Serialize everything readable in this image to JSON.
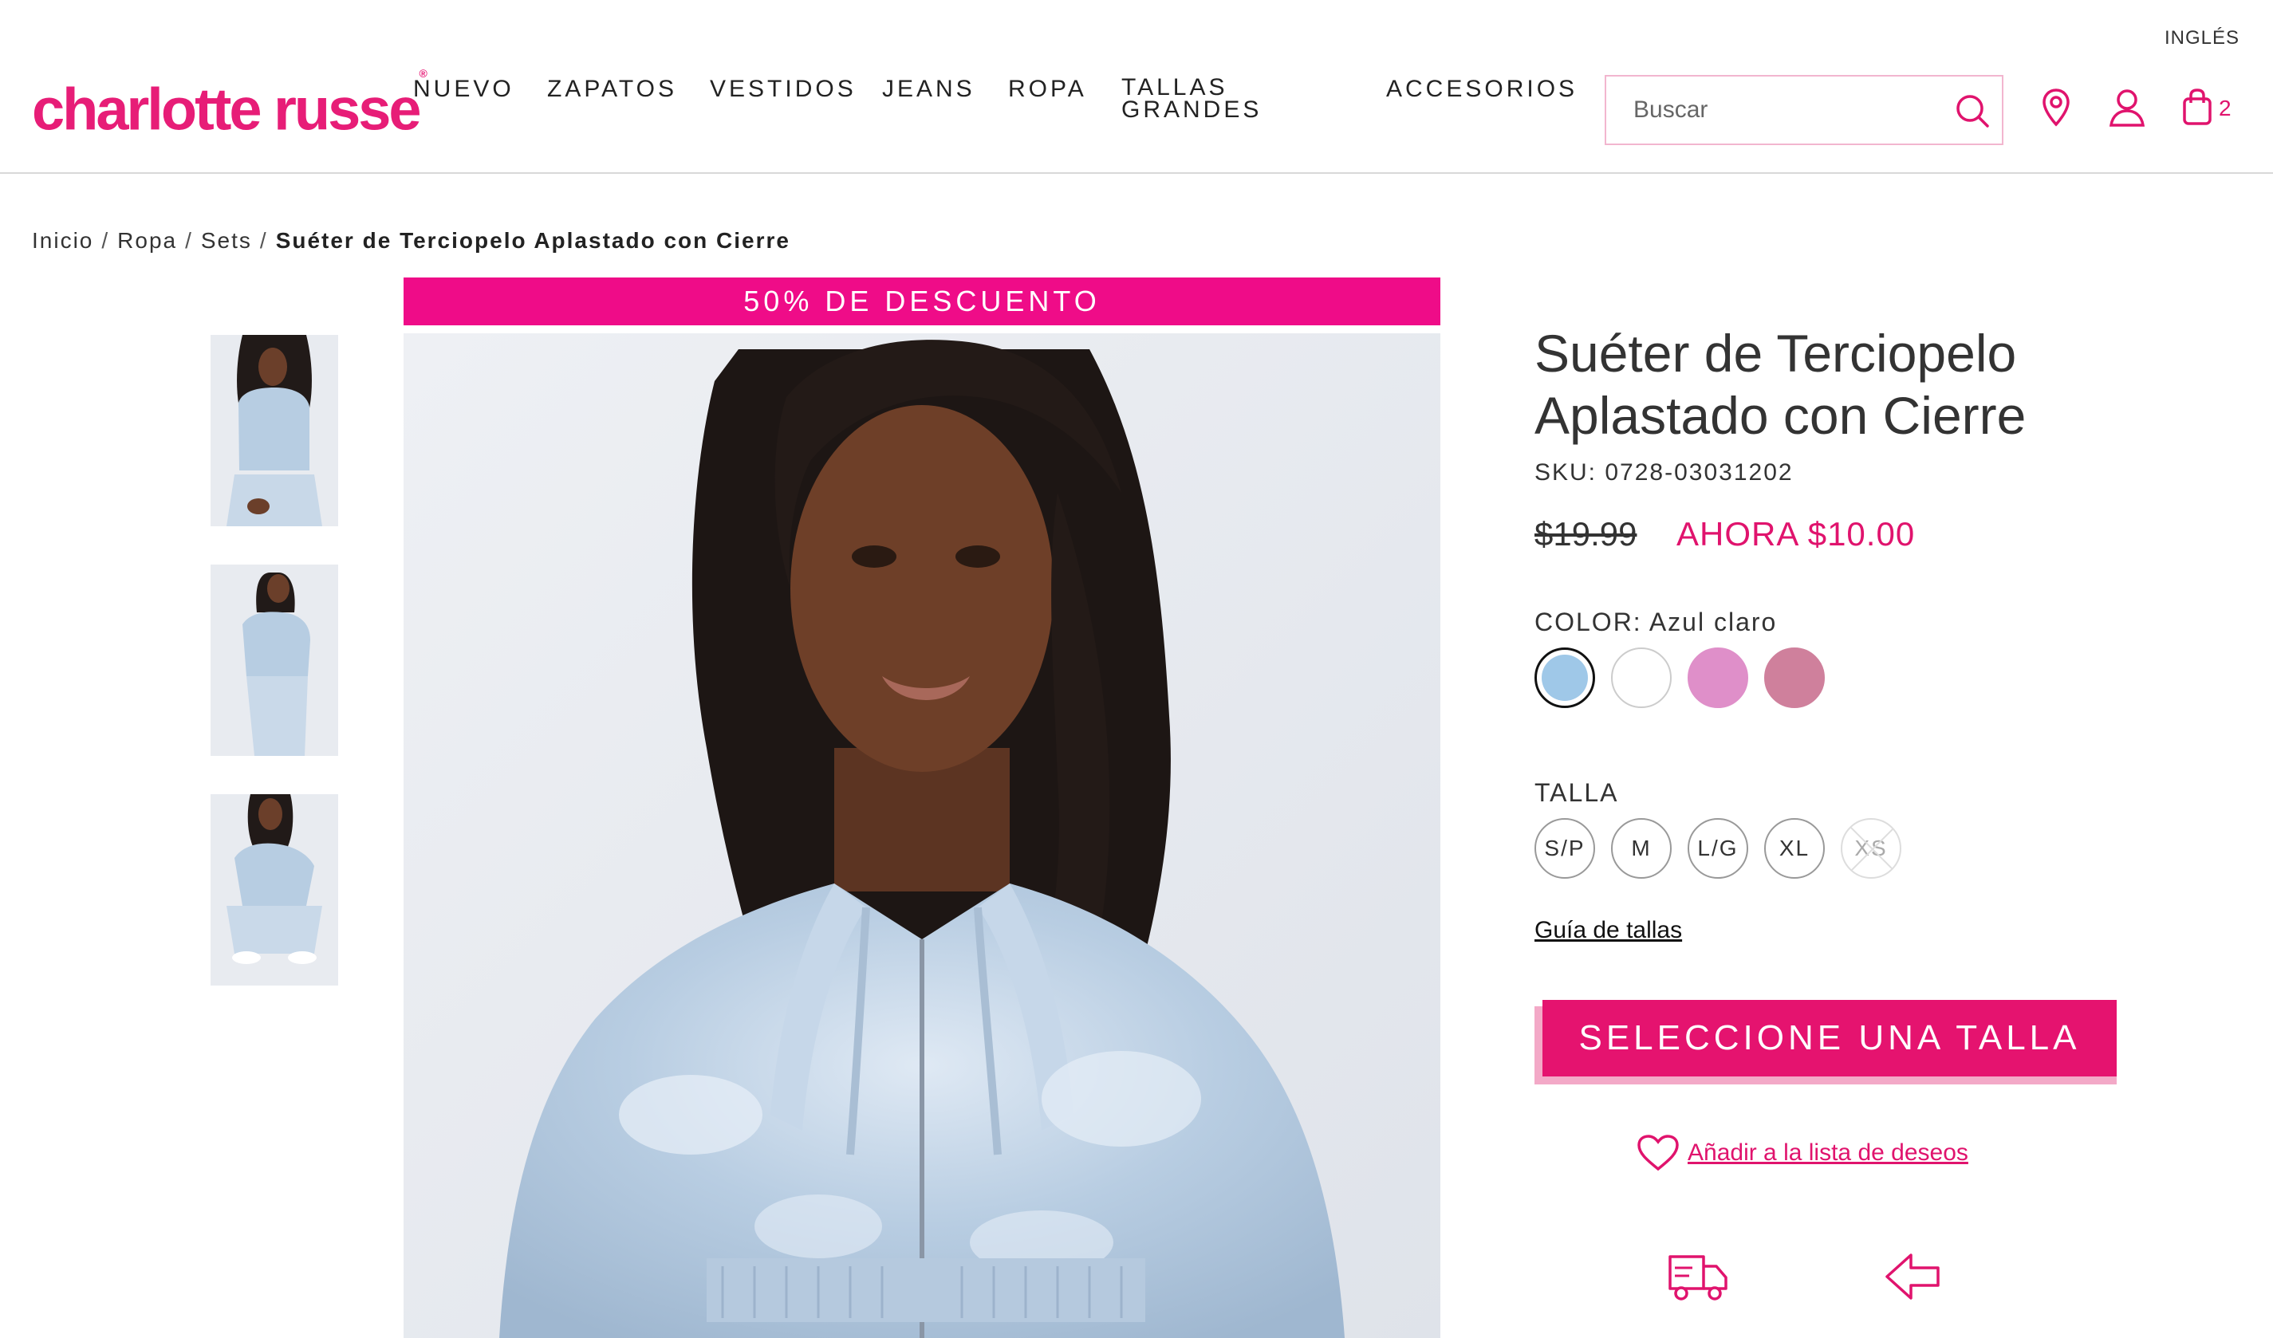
{
  "header": {
    "language": "INGLÉS",
    "logo": "charlotte russe",
    "nav": [
      "NUEVO",
      "ZAPATOS",
      "VESTIDOS",
      "JEANS",
      "ROPA",
      "TALLAS GRANDES",
      "ACCESORIOS"
    ],
    "nav_two_line": {
      "line1": "TALLAS",
      "line2": "GRANDES"
    },
    "search_placeholder": "Buscar",
    "cart_count": "2"
  },
  "breadcrumb": {
    "items": [
      "Inicio",
      "Ropa",
      "Sets"
    ],
    "current": "Suéter de Terciopelo Aplastado con Cierre"
  },
  "promo_banner": "50% DE DESCUENTO",
  "product": {
    "title": "Suéter de Terciopelo Aplastado con Cierre",
    "sku": "SKU: 0728-03031202",
    "old_price": "$19.99",
    "new_price": "AHORA $10.00",
    "color_label": "COLOR:",
    "color_value": "Azul claro",
    "swatches": [
      "#9fc8e8",
      "#ffffff",
      "#df8fc9",
      "#cf809c"
    ],
    "size_label": "TALLA",
    "sizes": [
      "S/P",
      "M",
      "L/G",
      "XL",
      "XS"
    ],
    "size_guide": "Guía de tallas",
    "cta": "SELECCIONE UNA TALLA",
    "wishlist": "Añadir a la lista de deseos"
  },
  "colors": {
    "brand_pink": "#e0136d",
    "promo_pink": "#ef0c88"
  }
}
